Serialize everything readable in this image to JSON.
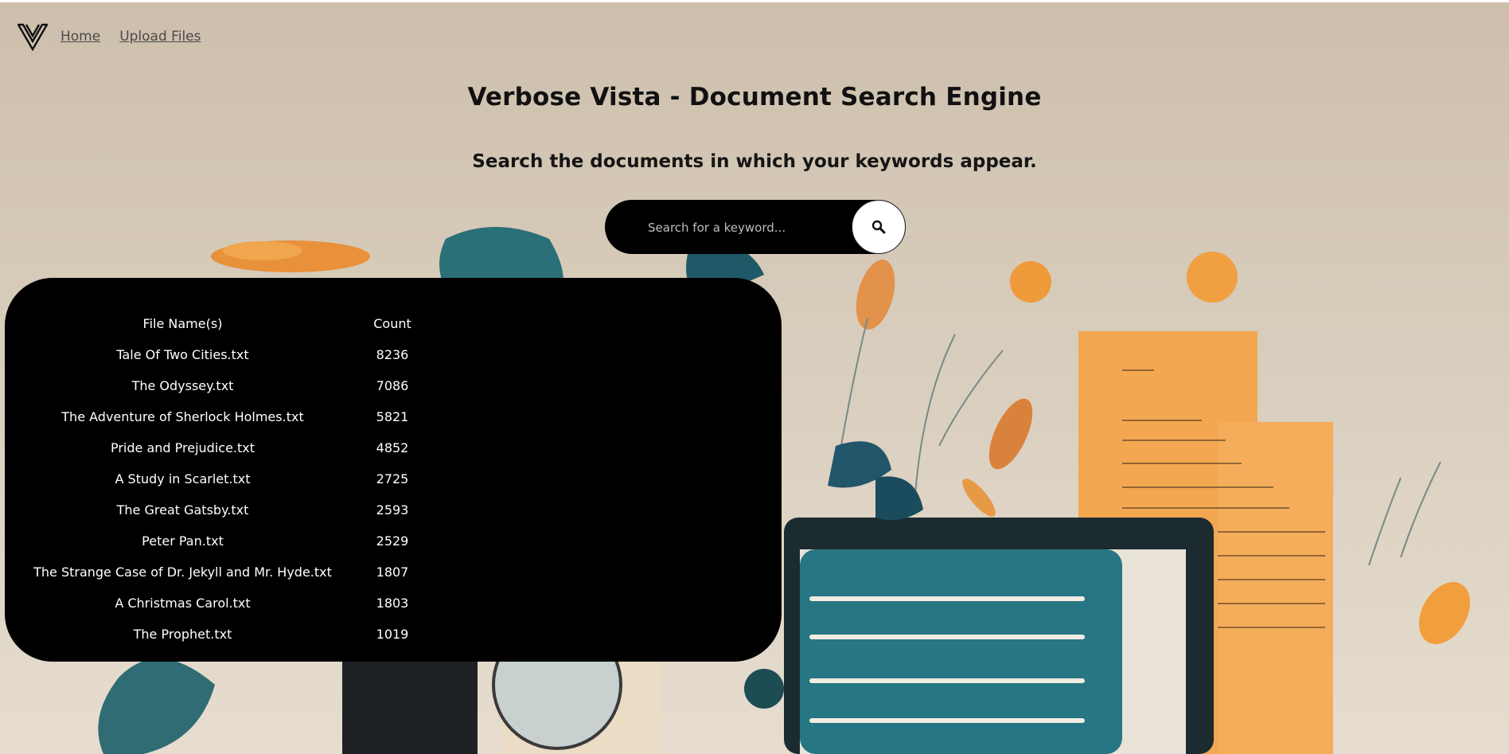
{
  "nav": {
    "home_label": "Home",
    "upload_label": "Upload Files"
  },
  "header": {
    "title": "Verbose Vista - Document Search Engine",
    "subtitle": "Search the documents in which your keywords appear."
  },
  "search": {
    "placeholder": "Search for a keyword...",
    "value": ""
  },
  "results": {
    "headers": [
      "File Name(s)",
      "Count"
    ],
    "rows": [
      {
        "file": "Tale Of Two Cities.txt",
        "count": "8236"
      },
      {
        "file": "The Odyssey.txt",
        "count": "7086"
      },
      {
        "file": "The Adventure of Sherlock Holmes.txt",
        "count": "5821"
      },
      {
        "file": "Pride and Prejudice.txt",
        "count": "4852"
      },
      {
        "file": "A Study in Scarlet.txt",
        "count": "2725"
      },
      {
        "file": "The Great Gatsby.txt",
        "count": "2593"
      },
      {
        "file": "Peter Pan.txt",
        "count": "2529"
      },
      {
        "file": "The Strange Case of Dr. Jekyll and Mr. Hyde.txt",
        "count": "1807"
      },
      {
        "file": "A Christmas Carol.txt",
        "count": "1803"
      },
      {
        "file": "The Prophet.txt",
        "count": "1019"
      }
    ]
  },
  "icons": {
    "logo": "v-logo-icon",
    "search": "search-icon"
  },
  "colors": {
    "background": "#d2c6b4",
    "panel": "#000000",
    "accent_orange": "#f0a040",
    "accent_teal": "#1f6f7a"
  }
}
